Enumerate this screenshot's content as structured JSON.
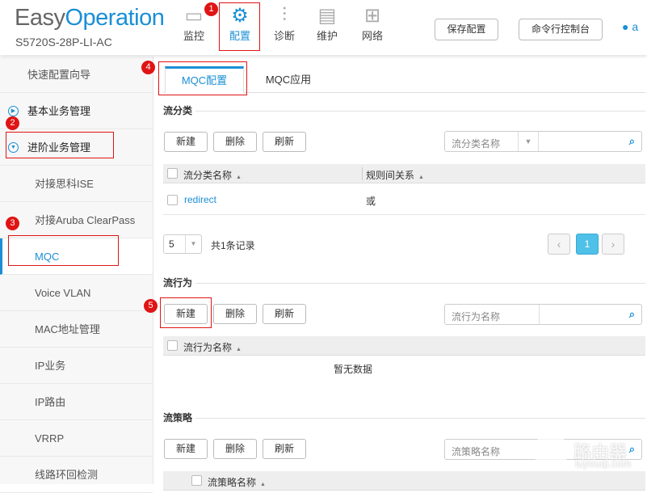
{
  "header": {
    "logo_a": "Easy",
    "logo_b": "Operation",
    "model": "S5720S-28P-LI-AC",
    "nav": [
      {
        "label": "监控",
        "icon": "monitor-icon"
      },
      {
        "label": "配置",
        "icon": "gear-icon",
        "active": true
      },
      {
        "label": "诊断",
        "icon": "sliders-icon"
      },
      {
        "label": "维护",
        "icon": "maintenance-icon"
      },
      {
        "label": "网络",
        "icon": "network-icon"
      }
    ],
    "save_label": "保存配置",
    "console_label": "命令行控制台",
    "user_initial": "a"
  },
  "sidebar": {
    "items": [
      "快速配置向导",
      "基本业务管理",
      "进阶业务管理",
      "对接思科ISE",
      "对接Aruba ClearPass",
      "MQC",
      "Voice VLAN",
      "MAC地址管理",
      "IP业务",
      "IP路由",
      "VRRP",
      "线路环回检测"
    ]
  },
  "tabs": [
    "MQC配置",
    "MQC应用"
  ],
  "classifier": {
    "title": "流分类",
    "new": "新建",
    "delete": "删除",
    "refresh": "刷新",
    "search_placeholder": "流分类名称",
    "col_name": "流分类名称",
    "col_relation": "规则间关系",
    "rows": [
      {
        "name": "redirect",
        "relation": "或"
      }
    ],
    "page_size": "5",
    "total": "共1条记录",
    "page": "1"
  },
  "behavior": {
    "title": "流行为",
    "new": "新建",
    "delete": "删除",
    "refresh": "刷新",
    "search_placeholder": "流行为名称",
    "col_name": "流行为名称",
    "empty": "暂无数据"
  },
  "policy": {
    "title": "流策略",
    "new": "新建",
    "delete": "删除",
    "refresh": "刷新",
    "search_placeholder": "流策略名称",
    "col_name": "流策略名称"
  },
  "annotations": [
    "1",
    "2",
    "3",
    "4",
    "5"
  ],
  "watermark": {
    "text": "路由器",
    "sub": "luyouqi.com"
  },
  "colors": {
    "accent": "#1a8fd6",
    "annotation": "#e01414"
  }
}
